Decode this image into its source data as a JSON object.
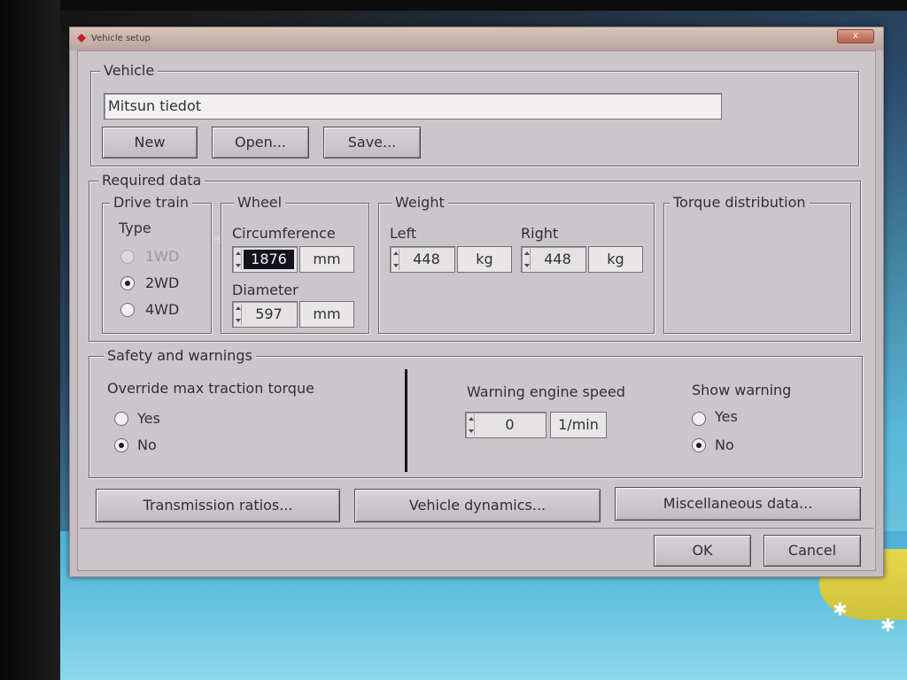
{
  "window": {
    "title": "Vehicle setup",
    "close_label": "x"
  },
  "vehicle": {
    "legend": "Vehicle",
    "name_value": "Mitsun tiedot",
    "buttons": {
      "new": "New",
      "open": "Open...",
      "save": "Save..."
    }
  },
  "required": {
    "legend": "Required data",
    "drive_train": {
      "legend": "Drive train",
      "type_label": "Type",
      "options": [
        {
          "label": "1WD",
          "selected": false,
          "enabled": false
        },
        {
          "label": "2WD",
          "selected": true,
          "enabled": true
        },
        {
          "label": "4WD",
          "selected": false,
          "enabled": true
        }
      ]
    },
    "wheel": {
      "legend": "Wheel",
      "circumference_label": "Circumference",
      "circumference_value": "1876",
      "circumference_unit": "mm",
      "diameter_label": "Diameter",
      "diameter_value": "597",
      "diameter_unit": "mm"
    },
    "weight": {
      "legend": "Weight",
      "left_label": "Left",
      "left_value": "448",
      "left_unit": "kg",
      "right_label": "Right",
      "right_value": "448",
      "right_unit": "kg"
    },
    "torque": {
      "legend": "Torque distribution"
    }
  },
  "safety": {
    "legend": "Safety and warnings",
    "override_label": "Override max traction torque",
    "override_options": [
      {
        "label": "Yes",
        "selected": false
      },
      {
        "label": "No",
        "selected": true
      }
    ],
    "warning_speed_label": "Warning engine speed",
    "warning_speed_value": "0",
    "warning_speed_unit": "1/min",
    "show_warning_label": "Show warning",
    "show_warning_options": [
      {
        "label": "Yes",
        "selected": false
      },
      {
        "label": "No",
        "selected": true
      }
    ]
  },
  "bottom_buttons": {
    "transmission": "Transmission ratios...",
    "dynamics": "Vehicle dynamics...",
    "misc": "Miscellaneous data..."
  },
  "dialog_buttons": {
    "ok": "OK",
    "cancel": "Cancel"
  }
}
